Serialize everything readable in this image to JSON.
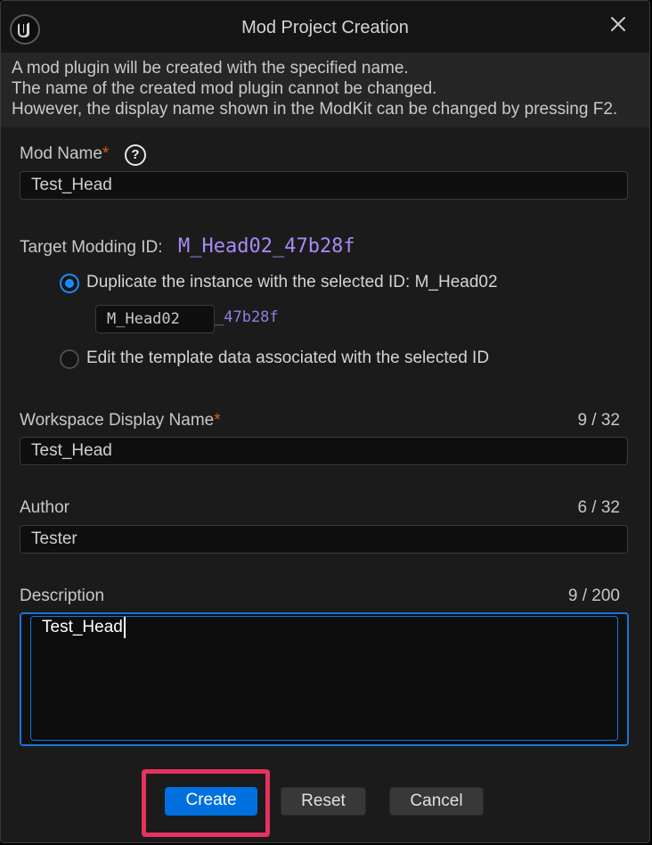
{
  "window": {
    "title": "Mod Project Creation",
    "logo_icon": "unreal-engine-logo",
    "close_icon": "close-icon"
  },
  "info": {
    "lines": [
      "A mod plugin will be created with the specified name.",
      "The name of the created mod plugin cannot be changed.",
      "However, the display name shown in the ModKit can be changed by pressing F2."
    ]
  },
  "mod_name": {
    "label": "Mod Name",
    "required_mark": "*",
    "help_icon": "?",
    "value": "Test_Head"
  },
  "target": {
    "label": "Target Modding ID:",
    "value": "M_Head02_47b28f"
  },
  "options": {
    "duplicate_label": "Duplicate the instance with the selected ID: M_Head02",
    "duplicate_selected": true,
    "prefix_value": "M_Head02",
    "suffix": "_47b28f",
    "edit_label": "Edit the template data associated with the selected ID",
    "edit_selected": false
  },
  "workspace": {
    "label": "Workspace Display Name",
    "required_mark": "*",
    "counter": "9 / 32",
    "value": "Test_Head"
  },
  "author": {
    "label": "Author",
    "counter": "6 / 32",
    "value": "Tester"
  },
  "description": {
    "label": "Description",
    "counter": "9 / 200",
    "value": "Test_Head"
  },
  "buttons": {
    "create": "Create",
    "reset": "Reset",
    "cancel": "Cancel"
  },
  "colors": {
    "accent": "#0070e0",
    "focus_border": "#1a74d9",
    "id_purple": "#a58bf5",
    "required": "#e2571f",
    "highlight": "#e5325f"
  }
}
